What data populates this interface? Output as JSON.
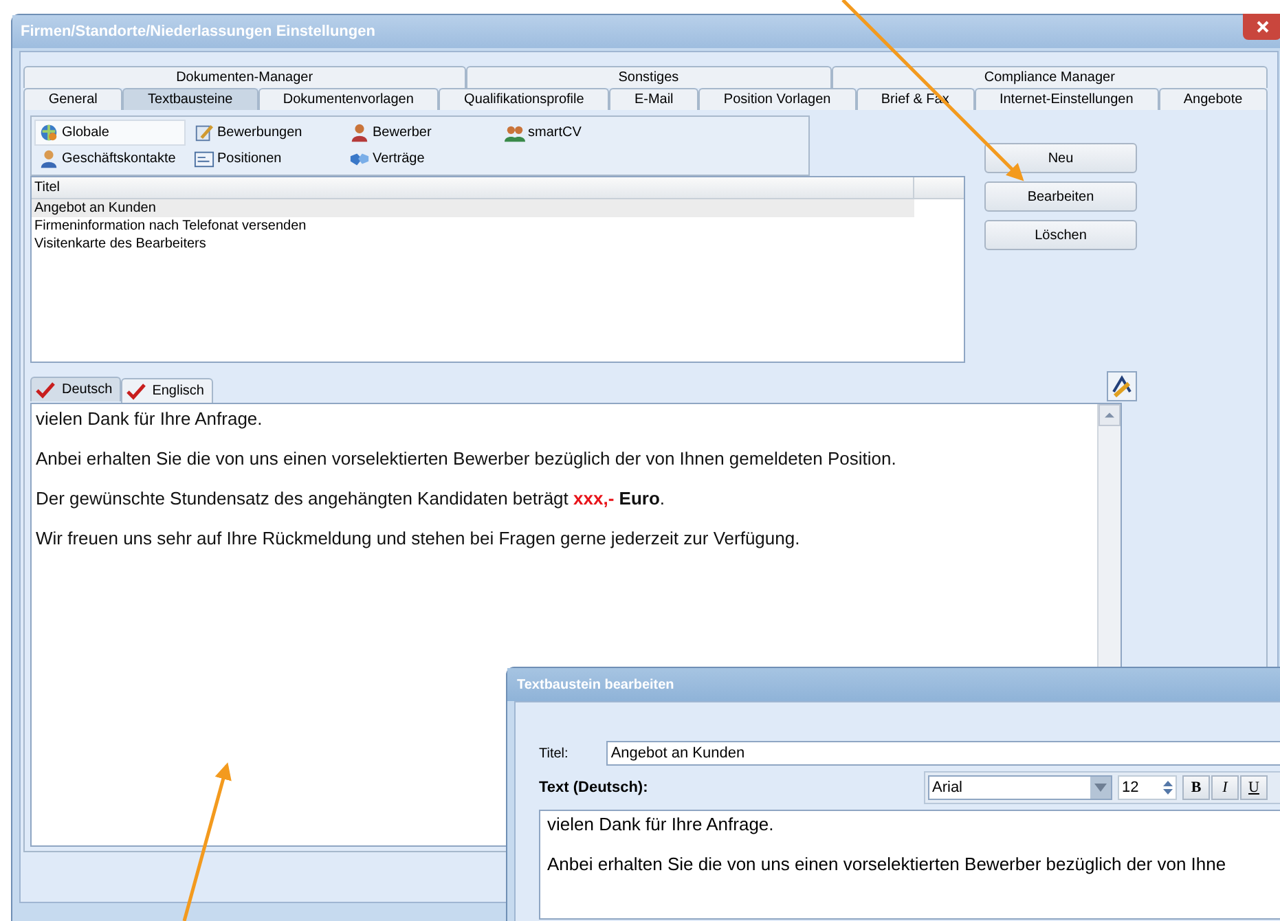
{
  "window": {
    "title": "Firmen/Standorte/Niederlassungen Einstellungen"
  },
  "tab_rows": [
    [
      {
        "label": "Dokumenten-Manager",
        "selected": false
      },
      {
        "label": "Sonstiges",
        "selected": false
      },
      {
        "label": "Compliance Manager",
        "selected": false
      }
    ],
    [
      {
        "label": "General",
        "selected": false
      },
      {
        "label": "Textbausteine",
        "selected": true
      },
      {
        "label": "Dokumentenvorlagen",
        "selected": false
      },
      {
        "label": "Qualifikationsprofile",
        "selected": false
      },
      {
        "label": "E-Mail",
        "selected": false
      },
      {
        "label": "Position Vorlagen",
        "selected": false
      },
      {
        "label": "Brief & Fax",
        "selected": false
      },
      {
        "label": "Internet-Einstellungen",
        "selected": false
      },
      {
        "label": "Angebote",
        "selected": false
      }
    ]
  ],
  "categories": [
    {
      "label": "Globale",
      "selected": true,
      "kind": "globe"
    },
    {
      "label": "Bewerbungen",
      "selected": false,
      "kind": "pen"
    },
    {
      "label": "Bewerber",
      "selected": false,
      "kind": "person"
    },
    {
      "label": "smartCV",
      "selected": false,
      "kind": "people"
    },
    {
      "label": "Geschäftskontakte",
      "selected": false,
      "kind": "contact"
    },
    {
      "label": "Positionen",
      "selected": false,
      "kind": "form"
    },
    {
      "label": "Verträge",
      "selected": false,
      "kind": "handshake"
    }
  ],
  "list": {
    "column": "Titel",
    "rows": [
      {
        "title": "Angebot an Kunden",
        "selected": true
      },
      {
        "title": "Firmeninformation nach Telefonat versenden",
        "selected": false
      },
      {
        "title": "Visitenkarte des Bearbeiters",
        "selected": false
      }
    ]
  },
  "buttons": [
    "Neu",
    "Bearbeiten",
    "Löschen"
  ],
  "language_tabs": [
    {
      "label": "Deutsch",
      "selected": true,
      "checked": true
    },
    {
      "label": "Englisch",
      "selected": false,
      "checked": true
    }
  ],
  "editor": {
    "paragraphs": [
      [
        {
          "kind": "plain",
          "text": "vielen Dank für Ihre Anfrage."
        }
      ],
      [
        {
          "kind": "plain",
          "text": "Anbei erhalten Sie die von uns einen vorselektierten Bewerber bezüglich der von Ihnen gemeldeten Position."
        }
      ],
      [
        {
          "kind": "plain",
          "text": "Der gewünschte Stundensatz des angehängten Kandidaten beträgt "
        },
        {
          "kind": "placeholder",
          "text": "xxx,-"
        },
        {
          "kind": "bold",
          "text": " Euro"
        },
        {
          "kind": "plain",
          "text": "."
        }
      ],
      [
        {
          "kind": "plain",
          "text": "Wir freuen uns sehr auf Ihre Rückmeldung und stehen bei Fragen gerne jederzeit zur Verfügung."
        }
      ]
    ]
  },
  "dialog": {
    "title": "Textbaustein bearbeiten",
    "title_label": "Titel:",
    "title_value": "Angebot an Kunden",
    "text_label": "Text (Deutsch):",
    "font": "Arial",
    "size": "12",
    "format_buttons": [
      "B",
      "I",
      "U"
    ],
    "paragraphs": [
      "vielen Dank für Ihre Anfrage.",
      "Anbei erhalten Sie die von uns einen vorselektierten Bewerber bezüglich der von Ihne"
    ]
  }
}
